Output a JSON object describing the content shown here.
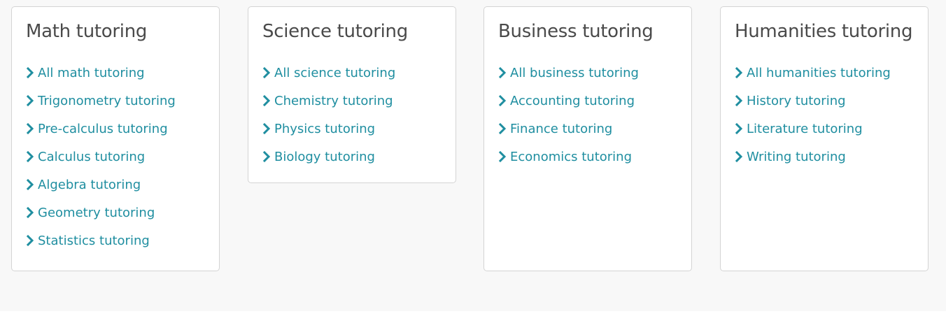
{
  "colors": {
    "link": "#1f8ea0",
    "heading": "#4a4a4a",
    "card_border": "#d4d4d4",
    "background": "#f8f8f8"
  },
  "categories": [
    {
      "title": "Math tutoring",
      "links": [
        "All math tutoring",
        "Trigonometry tutoring",
        "Pre-calculus tutoring",
        "Calculus tutoring",
        "Algebra tutoring",
        "Geometry tutoring",
        "Statistics tutoring"
      ]
    },
    {
      "title": "Science tutoring",
      "links": [
        "All science tutoring",
        "Chemistry tutoring",
        "Physics tutoring",
        "Biology tutoring"
      ]
    },
    {
      "title": "Business tutoring",
      "links": [
        "All business tutoring",
        "Accounting tutoring",
        "Finance tutoring",
        "Economics tutoring"
      ]
    },
    {
      "title": "Humanities tutoring",
      "links": [
        "All humanities tutoring",
        "History tutoring",
        "Literature tutoring",
        "Writing tutoring"
      ]
    }
  ]
}
